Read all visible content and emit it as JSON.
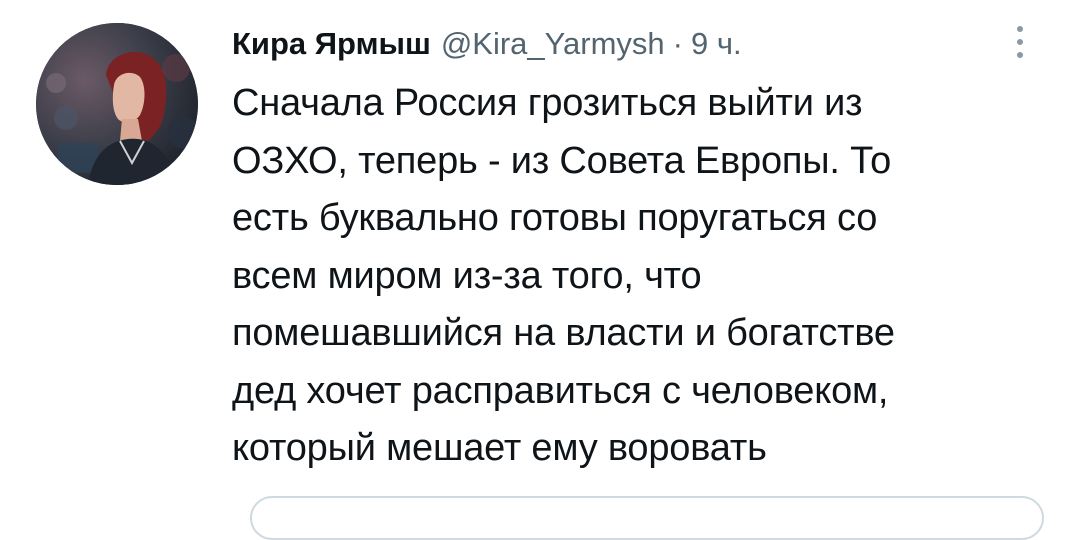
{
  "tweet": {
    "author_name": "Кира Ярмыш",
    "author_handle": "@Kira_Yarmysh",
    "separator": "·",
    "time": "9 ч.",
    "text_lines": [
      "Сначала Россия грозиться выйти из",
      "ОЗХО, теперь - из Совета Европы. То",
      "есть буквально готовы поругаться со",
      "всем миром из-за того, что",
      "помешавшийся на власти и богатстве",
      "дед хочет расправиться с человеком,",
      "который мешает ему воровать"
    ],
    "more_icon": "more-vertical-icon"
  },
  "colors": {
    "text_primary": "#0f1419",
    "text_secondary": "#536471",
    "border": "#cfd9de"
  }
}
